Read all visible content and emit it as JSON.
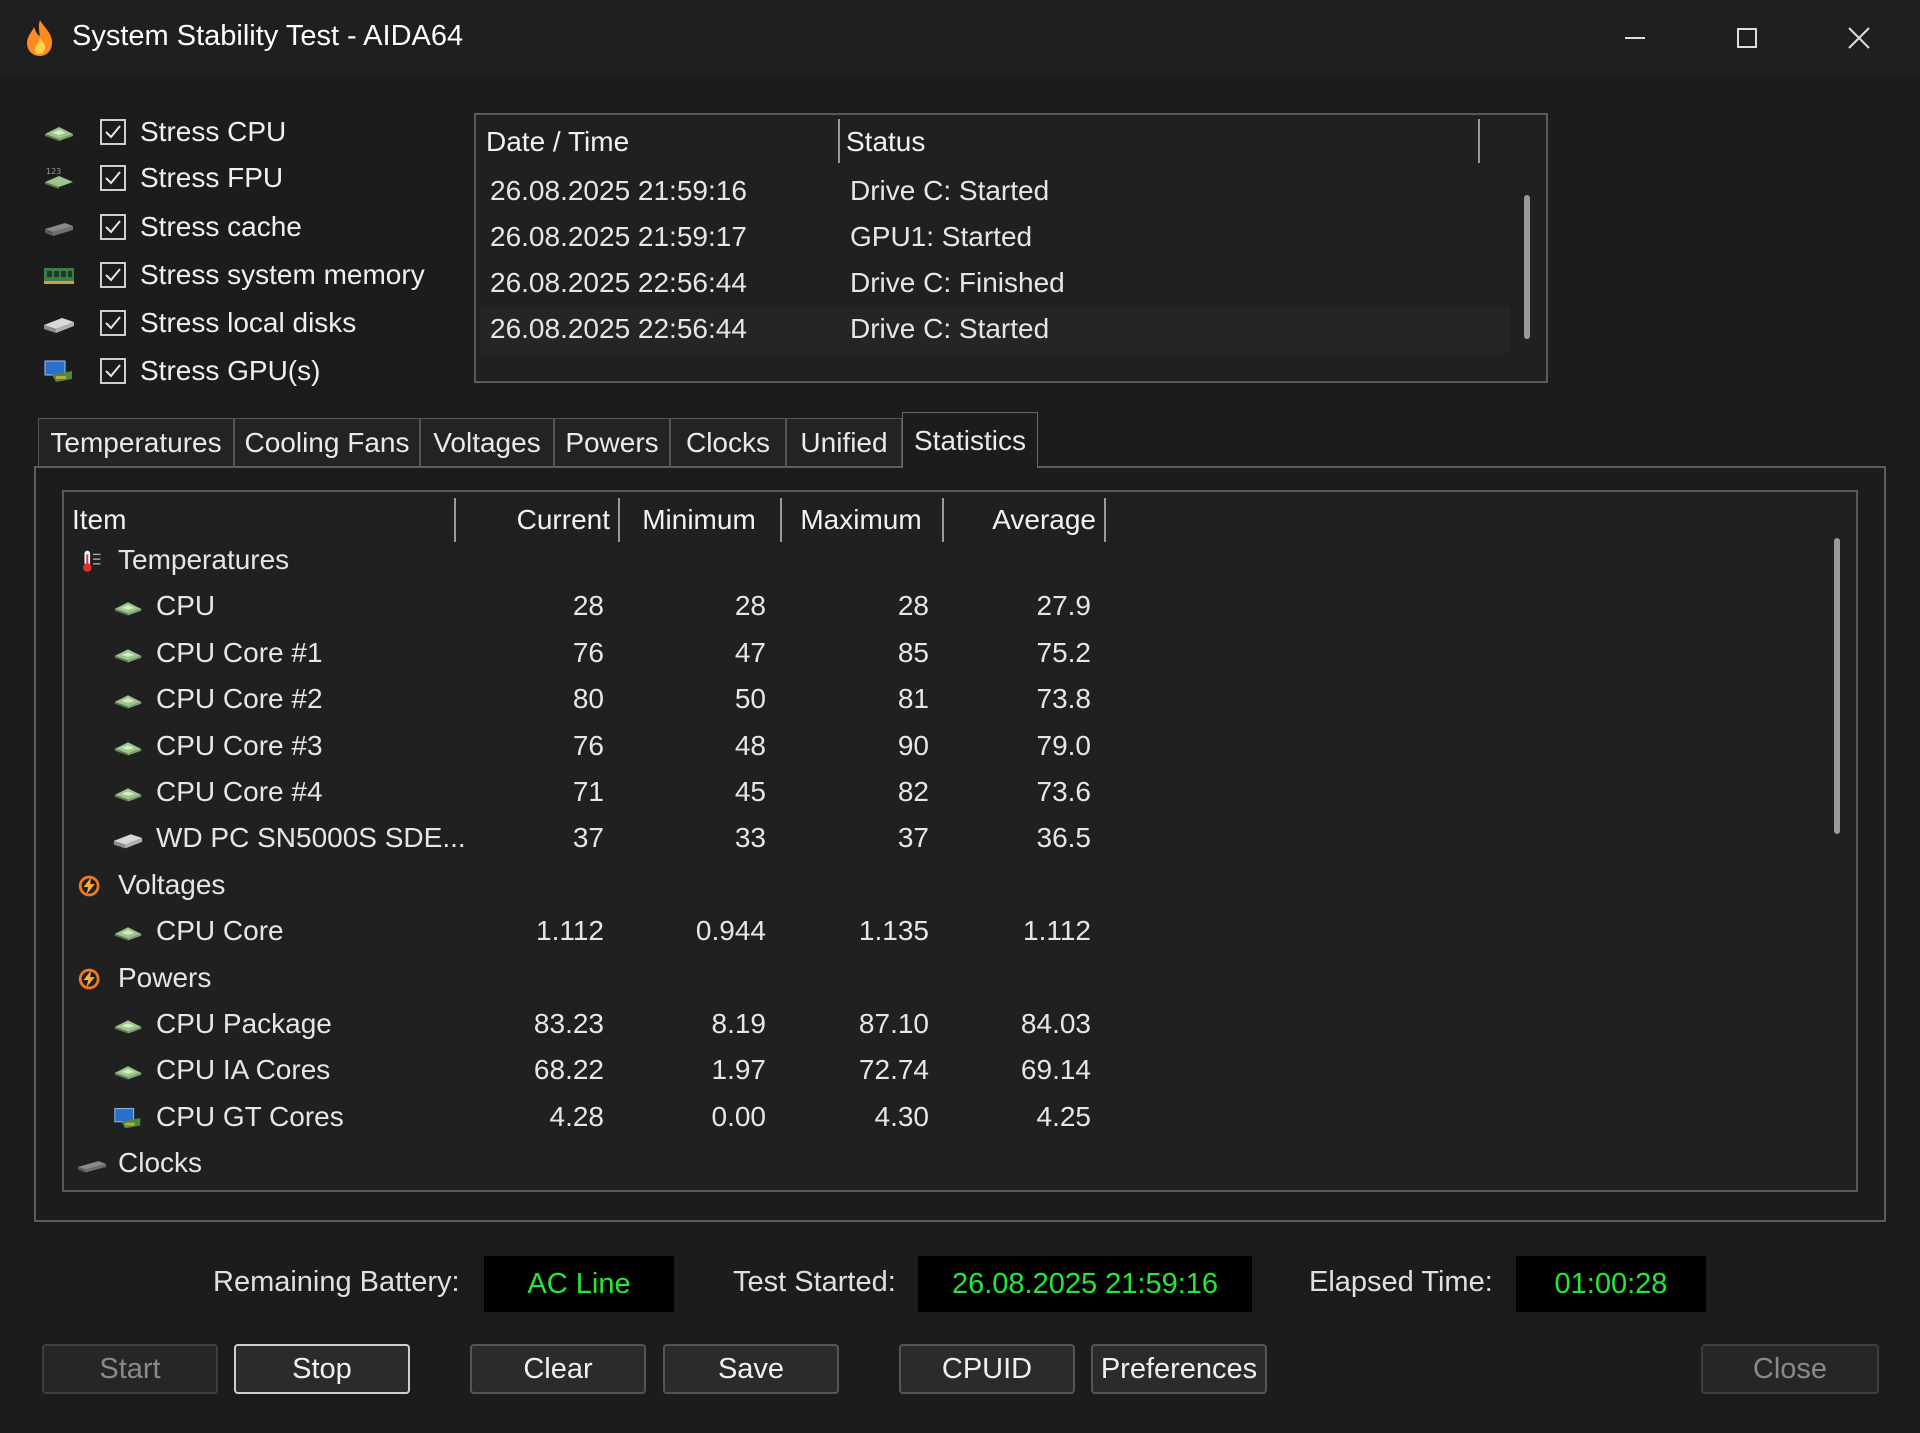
{
  "window": {
    "title": "System Stability Test - AIDA64"
  },
  "stress_options": [
    {
      "label": "Stress CPU",
      "checked": true,
      "icon": "cpu-chip-icon"
    },
    {
      "label": "Stress FPU",
      "checked": true,
      "icon": "fpu-chip-icon"
    },
    {
      "label": "Stress cache",
      "checked": true,
      "icon": "cache-icon"
    },
    {
      "label": "Stress system memory",
      "checked": true,
      "icon": "memory-module-icon"
    },
    {
      "label": "Stress local disks",
      "checked": true,
      "icon": "disk-drive-icon"
    },
    {
      "label": "Stress GPU(s)",
      "checked": true,
      "icon": "gpu-monitor-icon"
    }
  ],
  "log": {
    "headers": {
      "datetime": "Date / Time",
      "status": "Status"
    },
    "rows": [
      {
        "datetime": "26.08.2025 21:59:16",
        "status": "Drive C: Started"
      },
      {
        "datetime": "26.08.2025 21:59:17",
        "status": "GPU1: Started"
      },
      {
        "datetime": "26.08.2025 22:56:44",
        "status": "Drive C: Finished"
      },
      {
        "datetime": "26.08.2025 22:56:44",
        "status": "Drive C: Started"
      }
    ]
  },
  "tabs": [
    {
      "label": "Temperatures",
      "active": false
    },
    {
      "label": "Cooling Fans",
      "active": false
    },
    {
      "label": "Voltages",
      "active": false
    },
    {
      "label": "Powers",
      "active": false
    },
    {
      "label": "Clocks",
      "active": false
    },
    {
      "label": "Unified",
      "active": false
    },
    {
      "label": "Statistics",
      "active": true
    }
  ],
  "stats": {
    "headers": {
      "item": "Item",
      "current": "Current",
      "minimum": "Minimum",
      "maximum": "Maximum",
      "average": "Average"
    },
    "rows": [
      {
        "group": true,
        "item": "Temperatures",
        "icon": "thermometer-icon"
      },
      {
        "item": "CPU",
        "current": "28",
        "minimum": "28",
        "maximum": "28",
        "average": "27.9",
        "icon": "cpu-chip-icon"
      },
      {
        "item": "CPU Core #1",
        "current": "76",
        "minimum": "47",
        "maximum": "85",
        "average": "75.2",
        "icon": "cpu-chip-icon"
      },
      {
        "item": "CPU Core #2",
        "current": "80",
        "minimum": "50",
        "maximum": "81",
        "average": "73.8",
        "icon": "cpu-chip-icon"
      },
      {
        "item": "CPU Core #3",
        "current": "76",
        "minimum": "48",
        "maximum": "90",
        "average": "79.0",
        "icon": "cpu-chip-icon"
      },
      {
        "item": "CPU Core #4",
        "current": "71",
        "minimum": "45",
        "maximum": "82",
        "average": "73.6",
        "icon": "cpu-chip-icon"
      },
      {
        "item": "WD PC SN5000S SDE...",
        "current": "37",
        "minimum": "33",
        "maximum": "37",
        "average": "36.5",
        "icon": "disk-drive-icon"
      },
      {
        "group": true,
        "item": "Voltages",
        "icon": "power-bolt-icon"
      },
      {
        "item": "CPU Core",
        "current": "1.112",
        "minimum": "0.944",
        "maximum": "1.135",
        "average": "1.112",
        "icon": "cpu-chip-icon"
      },
      {
        "group": true,
        "item": "Powers",
        "icon": "power-bolt-icon"
      },
      {
        "item": "CPU Package",
        "current": "83.23",
        "minimum": "8.19",
        "maximum": "87.10",
        "average": "84.03",
        "icon": "cpu-chip-icon"
      },
      {
        "item": "CPU IA Cores",
        "current": "68.22",
        "minimum": "1.97",
        "maximum": "72.74",
        "average": "69.14",
        "icon": "cpu-chip-icon"
      },
      {
        "item": "CPU GT Cores",
        "current": "4.28",
        "minimum": "0.00",
        "maximum": "4.30",
        "average": "4.25",
        "icon": "gpu-monitor-icon"
      },
      {
        "group": true,
        "item": "Clocks",
        "icon": "clock-chip-icon"
      }
    ]
  },
  "footer": {
    "battery_label": "Remaining Battery:",
    "battery_value": "AC Line",
    "started_label": "Test Started:",
    "started_value": "26.08.2025 21:59:16",
    "elapsed_label": "Elapsed Time:",
    "elapsed_value": "01:00:28"
  },
  "buttons": {
    "start": "Start",
    "stop": "Stop",
    "clear": "Clear",
    "save": "Save",
    "cpuid": "CPUID",
    "preferences": "Preferences",
    "close": "Close"
  },
  "colors": {
    "accent_green": "#22e83a",
    "background": "#1c1c1c",
    "flame": "#ff8a1f"
  }
}
